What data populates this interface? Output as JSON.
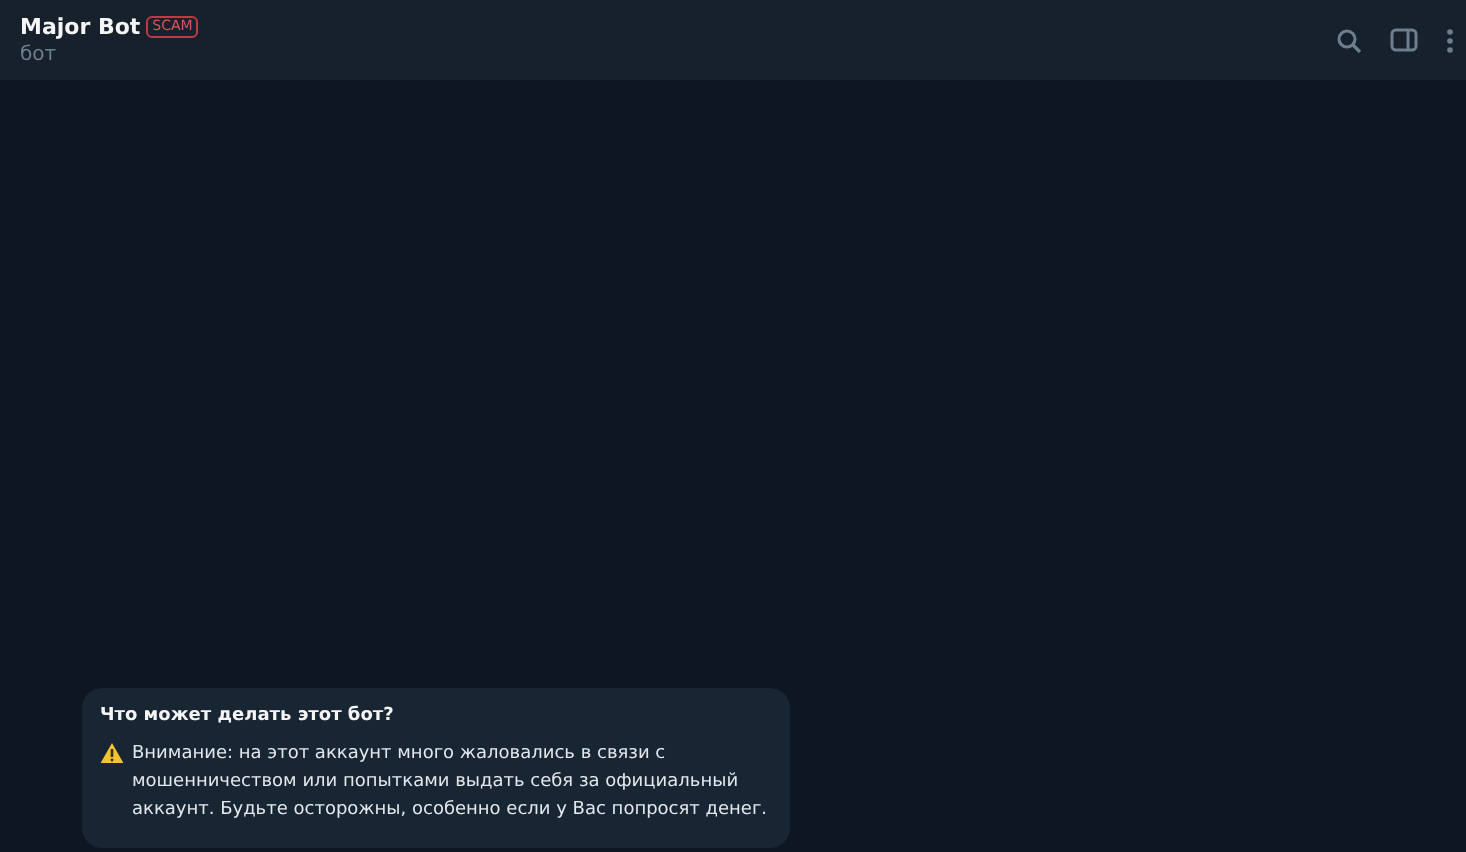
{
  "header": {
    "title": "Major Bot",
    "badge": "SCAM",
    "subtitle": "бот"
  },
  "info_card": {
    "title": "Что может делать этот бот?",
    "text": "Внимание: на этот аккаунт много жаловались в связи с мошенничеством или попытками выдать себя за официальный аккаунт. Будьте осторожны, особенно если у Вас попросят денег."
  }
}
